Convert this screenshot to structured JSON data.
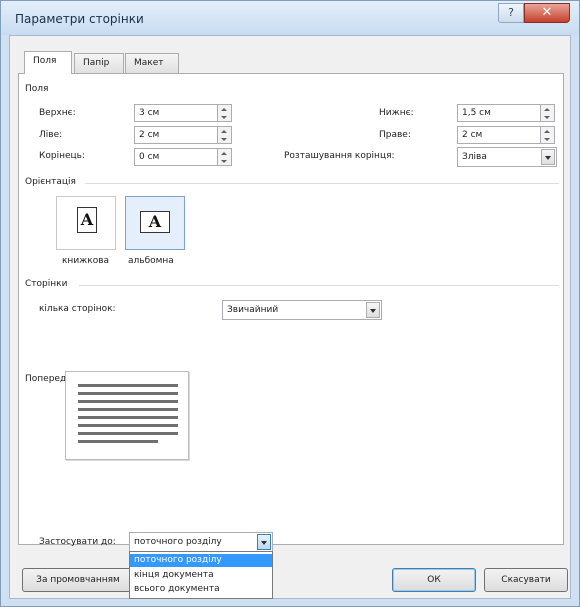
{
  "window": {
    "title": "Параметри сторінки",
    "help": "?",
    "close": "✕"
  },
  "tabs": [
    {
      "label": "Поля"
    },
    {
      "label": "Папір"
    },
    {
      "label": "Макет"
    }
  ],
  "margins": {
    "group_label": "Поля",
    "top_label": "Верхнє:",
    "top_value": "3 см",
    "left_label": "Ліве:",
    "left_value": "2 см",
    "gutter_label": "Корінець:",
    "gutter_value": "0 см",
    "bottom_label": "Нижнє:",
    "bottom_value": "1,5 см",
    "right_label": "Праве:",
    "right_value": "2 см",
    "gutter_pos_label": "Розташування корінця:",
    "gutter_pos_value": "Зліва"
  },
  "orientation": {
    "group_label": "Орієнтація",
    "portrait_label": "книжкова",
    "landscape_label": "альбомна",
    "glyph": "A",
    "selected": "landscape"
  },
  "pages": {
    "group_label": "Сторінки",
    "multiple_label": "кілька сторінок:",
    "multiple_value": "Звичайний"
  },
  "preview": {
    "group_label": "Попередній перегляд"
  },
  "apply": {
    "label": "Застосувати до:",
    "value": "поточного розділу",
    "options": [
      "поточного розділу",
      "кінця документа",
      "всього документа"
    ],
    "highlighted_index": 0
  },
  "buttons": {
    "default": "За промовчанням",
    "ok": "ОК",
    "cancel": "Скасувати"
  },
  "colors": {
    "highlight": "#3399ff",
    "close_button": "#c6402e",
    "titlebar": "#cfe0f2"
  }
}
